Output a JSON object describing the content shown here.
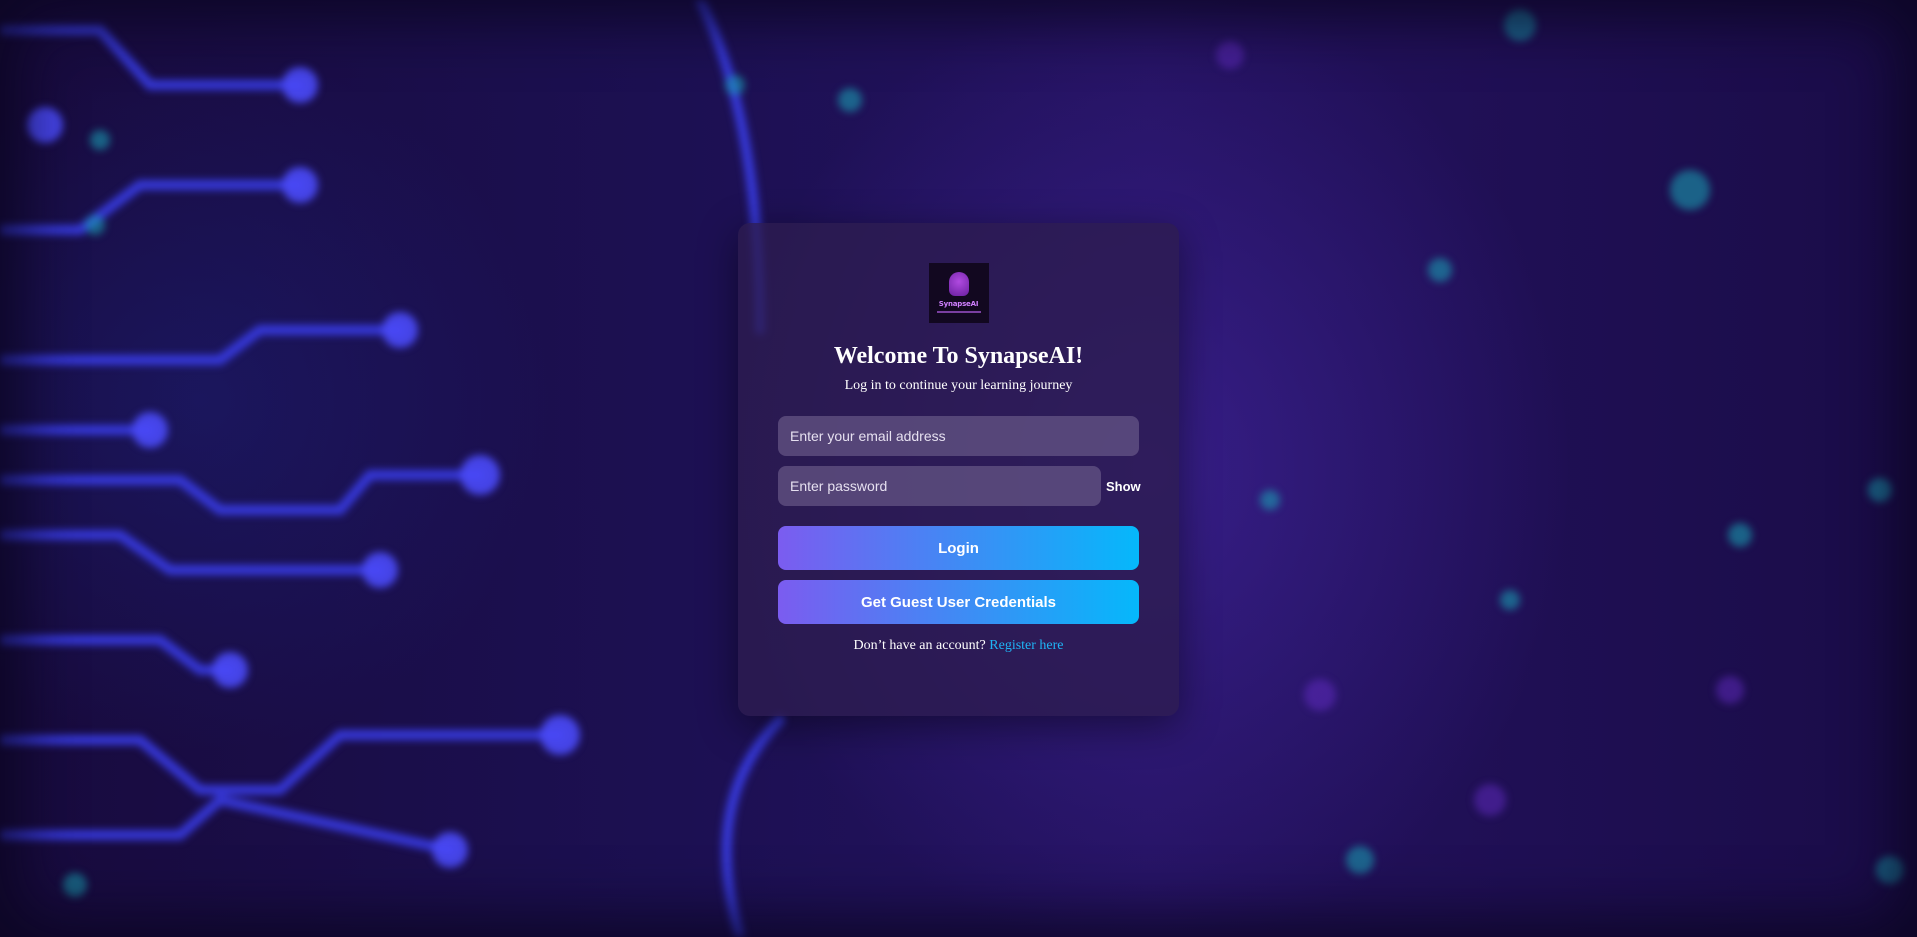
{
  "login": {
    "logo_text": "SynapseAI",
    "title": "Welcome To SynapseAI!",
    "subtitle": "Log in to continue your learning journey",
    "email_placeholder": "Enter your email address",
    "email_value": "",
    "password_placeholder": "Enter password",
    "password_value": "",
    "show_label": "Show",
    "login_label": "Login",
    "guest_label": "Get Guest User Credentials",
    "register_prompt": "Don’t have an account?",
    "register_link": "Register here"
  },
  "colors": {
    "gradient_start": "#7b5cf0",
    "gradient_end": "#05b8fb",
    "link": "#1fb4f5",
    "background": "#1c1052"
  }
}
